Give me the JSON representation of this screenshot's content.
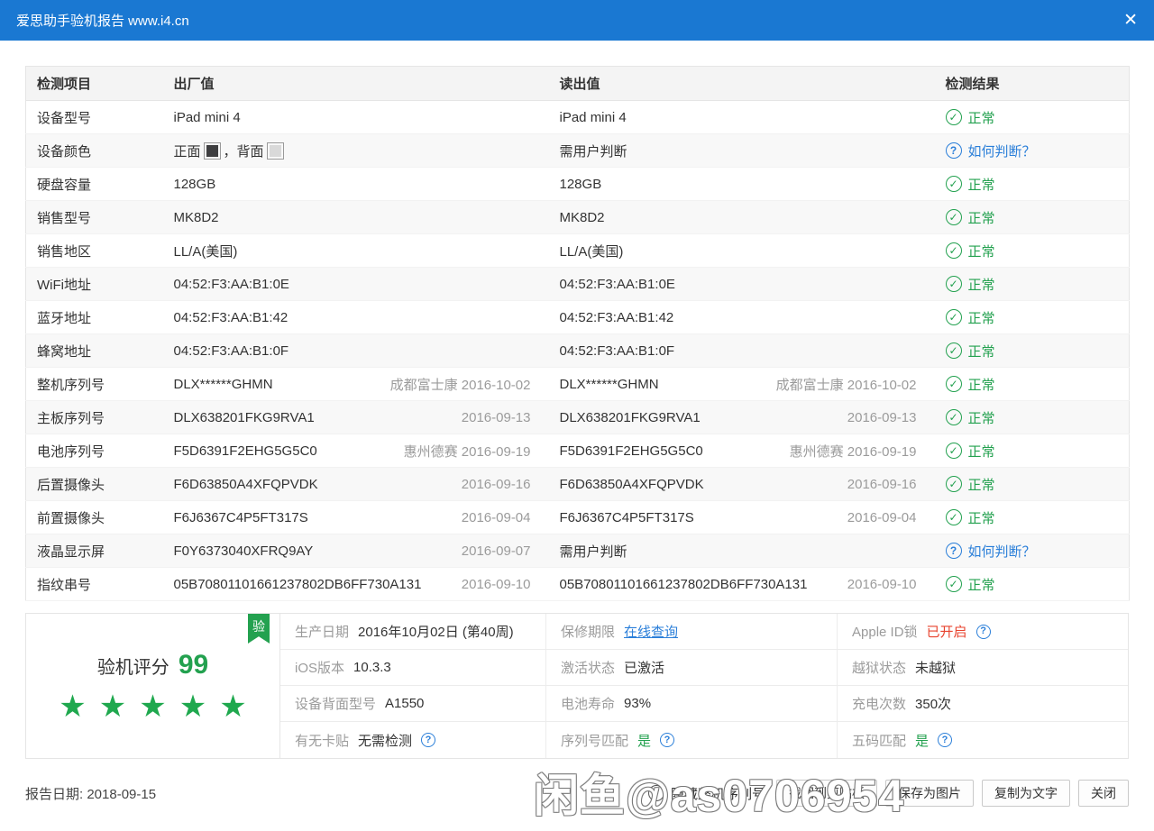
{
  "titlebar": {
    "title": "爱思助手验机报告 www.i4.cn",
    "close_glyph": "✕"
  },
  "table": {
    "headers": [
      "检测项目",
      "出厂值",
      "读出值",
      "检测结果"
    ],
    "rows": [
      {
        "item": "设备型号",
        "factory": {
          "text": "iPad mini 4"
        },
        "read": {
          "text": "iPad mini 4"
        },
        "result": {
          "type": "ok",
          "label": "正常"
        }
      },
      {
        "item": "设备颜色",
        "factory": {
          "swatches": [
            {
              "label": "正面",
              "color": "#3e3e40"
            },
            {
              "label": "，背面",
              "color": "#d9d9d9"
            }
          ]
        },
        "read": {
          "text": "需用户判断"
        },
        "result": {
          "type": "question",
          "label": "如何判断？"
        }
      },
      {
        "item": "硬盘容量",
        "factory": {
          "text": "128GB"
        },
        "read": {
          "text": "128GB"
        },
        "result": {
          "type": "ok",
          "label": "正常"
        }
      },
      {
        "item": "销售型号",
        "factory": {
          "text": "MK8D2"
        },
        "read": {
          "text": "MK8D2"
        },
        "result": {
          "type": "ok",
          "label": "正常"
        }
      },
      {
        "item": "销售地区",
        "factory": {
          "text": "LL/A(美国)"
        },
        "read": {
          "text": "LL/A(美国)"
        },
        "result": {
          "type": "ok",
          "label": "正常"
        }
      },
      {
        "item": "WiFi地址",
        "factory": {
          "text": "04:52:F3:AA:B1:0E"
        },
        "read": {
          "text": "04:52:F3:AA:B1:0E"
        },
        "result": {
          "type": "ok",
          "label": "正常"
        }
      },
      {
        "item": "蓝牙地址",
        "factory": {
          "text": "04:52:F3:AA:B1:42"
        },
        "read": {
          "text": "04:52:F3:AA:B1:42"
        },
        "result": {
          "type": "ok",
          "label": "正常"
        }
      },
      {
        "item": "蜂窝地址",
        "factory": {
          "text": "04:52:F3:AA:B1:0F"
        },
        "read": {
          "text": "04:52:F3:AA:B1:0F"
        },
        "result": {
          "type": "ok",
          "label": "正常"
        }
      },
      {
        "item": "整机序列号",
        "factory": {
          "text": "DLX******GHMN",
          "extra": "成都富士康 2016-10-02"
        },
        "read": {
          "text": "DLX******GHMN",
          "extra": "成都富士康 2016-10-02"
        },
        "result": {
          "type": "ok",
          "label": "正常"
        }
      },
      {
        "item": "主板序列号",
        "factory": {
          "text": "DLX638201FKG9RVA1",
          "extra": "2016-09-13"
        },
        "read": {
          "text": "DLX638201FKG9RVA1",
          "extra": "2016-09-13"
        },
        "result": {
          "type": "ok",
          "label": "正常"
        }
      },
      {
        "item": "电池序列号",
        "factory": {
          "text": "F5D6391F2EHG5G5C0",
          "extra": "惠州德赛 2016-09-19"
        },
        "read": {
          "text": "F5D6391F2EHG5G5C0",
          "extra": "惠州德赛 2016-09-19"
        },
        "result": {
          "type": "ok",
          "label": "正常"
        }
      },
      {
        "item": "后置摄像头",
        "factory": {
          "text": "F6D63850A4XFQPVDK",
          "extra": "2016-09-16"
        },
        "read": {
          "text": "F6D63850A4XFQPVDK",
          "extra": "2016-09-16"
        },
        "result": {
          "type": "ok",
          "label": "正常"
        }
      },
      {
        "item": "前置摄像头",
        "factory": {
          "text": "F6J6367C4P5FT317S",
          "extra": "2016-09-04"
        },
        "read": {
          "text": "F6J6367C4P5FT317S",
          "extra": "2016-09-04"
        },
        "result": {
          "type": "ok",
          "label": "正常"
        }
      },
      {
        "item": "液晶显示屏",
        "factory": {
          "text": "F0Y6373040XFRQ9AY",
          "extra": "2016-09-07"
        },
        "read": {
          "text": "需用户判断"
        },
        "result": {
          "type": "question",
          "label": "如何判断？"
        }
      },
      {
        "item": "指纹串号",
        "factory": {
          "text": "05B70801101661237802DB6FF730A131",
          "extra": "2016-09-10"
        },
        "read": {
          "text": "05B70801101661237802DB6FF730A131",
          "extra": "2016-09-10"
        },
        "result": {
          "type": "ok",
          "label": "正常"
        }
      }
    ]
  },
  "summary": {
    "ribbon": "验",
    "score_label": "验机评分",
    "score": "99",
    "stars": 5,
    "star_glyph": "★",
    "grid": [
      [
        {
          "label": "生产日期",
          "value": "2016年10月02日 (第40周)"
        },
        {
          "label": "保修期限",
          "value": "在线查询",
          "value_type": "link"
        },
        {
          "label": "Apple ID锁",
          "value": "已开启",
          "value_type": "danger",
          "question": true
        }
      ],
      [
        {
          "label": "iOS版本",
          "value": "10.3.3"
        },
        {
          "label": "激活状态",
          "value": "已激活"
        },
        {
          "label": "越狱状态",
          "value": "未越狱"
        }
      ],
      [
        {
          "label": "设备背面型号",
          "value": "A1550"
        },
        {
          "label": "电池寿命",
          "value": "93%"
        },
        {
          "label": "充电次数",
          "value": "350次"
        }
      ],
      [
        {
          "label": "有无卡贴",
          "value": "无需检测",
          "question": true
        },
        {
          "label": "序列号匹配",
          "value": "是",
          "value_type": "ok",
          "question": true
        },
        {
          "label": "五码匹配",
          "value": "是",
          "value_type": "ok",
          "question": true
        }
      ]
    ]
  },
  "footer": {
    "report_date": "报告日期: 2018-09-15",
    "hide_serial_label": "隐藏整机序列号",
    "buttons": [
      "截图到剪贴板",
      "保存为图片",
      "复制为文字",
      "关闭"
    ]
  },
  "watermark": "闲鱼@as0706954",
  "colors": {
    "accent_blue": "#1a78d2",
    "ok_green": "#23a14f",
    "link_blue": "#2b7fd9",
    "danger_red": "#e8432e"
  }
}
